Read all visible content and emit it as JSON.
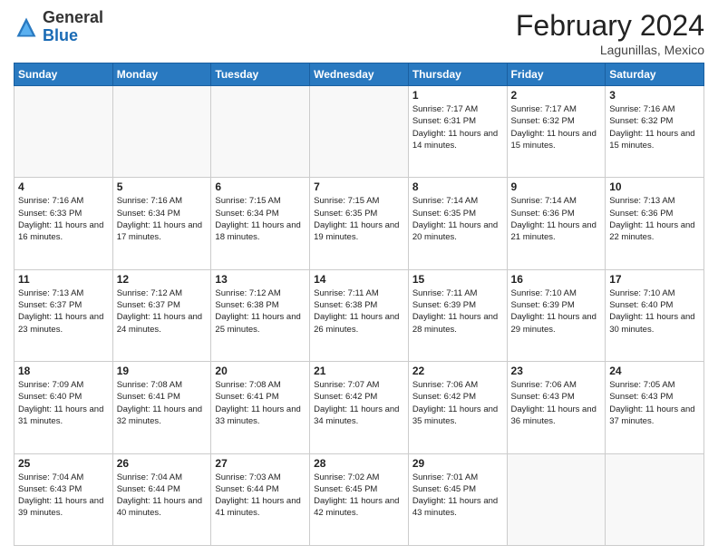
{
  "header": {
    "logo_general": "General",
    "logo_blue": "Blue",
    "month_year": "February 2024",
    "location": "Lagunillas, Mexico"
  },
  "weekdays": [
    "Sunday",
    "Monday",
    "Tuesday",
    "Wednesday",
    "Thursday",
    "Friday",
    "Saturday"
  ],
  "weeks": [
    [
      {
        "day": "",
        "info": ""
      },
      {
        "day": "",
        "info": ""
      },
      {
        "day": "",
        "info": ""
      },
      {
        "day": "",
        "info": ""
      },
      {
        "day": "1",
        "info": "Sunrise: 7:17 AM\nSunset: 6:31 PM\nDaylight: 11 hours and 14 minutes."
      },
      {
        "day": "2",
        "info": "Sunrise: 7:17 AM\nSunset: 6:32 PM\nDaylight: 11 hours and 15 minutes."
      },
      {
        "day": "3",
        "info": "Sunrise: 7:16 AM\nSunset: 6:32 PM\nDaylight: 11 hours and 15 minutes."
      }
    ],
    [
      {
        "day": "4",
        "info": "Sunrise: 7:16 AM\nSunset: 6:33 PM\nDaylight: 11 hours and 16 minutes."
      },
      {
        "day": "5",
        "info": "Sunrise: 7:16 AM\nSunset: 6:34 PM\nDaylight: 11 hours and 17 minutes."
      },
      {
        "day": "6",
        "info": "Sunrise: 7:15 AM\nSunset: 6:34 PM\nDaylight: 11 hours and 18 minutes."
      },
      {
        "day": "7",
        "info": "Sunrise: 7:15 AM\nSunset: 6:35 PM\nDaylight: 11 hours and 19 minutes."
      },
      {
        "day": "8",
        "info": "Sunrise: 7:14 AM\nSunset: 6:35 PM\nDaylight: 11 hours and 20 minutes."
      },
      {
        "day": "9",
        "info": "Sunrise: 7:14 AM\nSunset: 6:36 PM\nDaylight: 11 hours and 21 minutes."
      },
      {
        "day": "10",
        "info": "Sunrise: 7:13 AM\nSunset: 6:36 PM\nDaylight: 11 hours and 22 minutes."
      }
    ],
    [
      {
        "day": "11",
        "info": "Sunrise: 7:13 AM\nSunset: 6:37 PM\nDaylight: 11 hours and 23 minutes."
      },
      {
        "day": "12",
        "info": "Sunrise: 7:12 AM\nSunset: 6:37 PM\nDaylight: 11 hours and 24 minutes."
      },
      {
        "day": "13",
        "info": "Sunrise: 7:12 AM\nSunset: 6:38 PM\nDaylight: 11 hours and 25 minutes."
      },
      {
        "day": "14",
        "info": "Sunrise: 7:11 AM\nSunset: 6:38 PM\nDaylight: 11 hours and 26 minutes."
      },
      {
        "day": "15",
        "info": "Sunrise: 7:11 AM\nSunset: 6:39 PM\nDaylight: 11 hours and 28 minutes."
      },
      {
        "day": "16",
        "info": "Sunrise: 7:10 AM\nSunset: 6:39 PM\nDaylight: 11 hours and 29 minutes."
      },
      {
        "day": "17",
        "info": "Sunrise: 7:10 AM\nSunset: 6:40 PM\nDaylight: 11 hours and 30 minutes."
      }
    ],
    [
      {
        "day": "18",
        "info": "Sunrise: 7:09 AM\nSunset: 6:40 PM\nDaylight: 11 hours and 31 minutes."
      },
      {
        "day": "19",
        "info": "Sunrise: 7:08 AM\nSunset: 6:41 PM\nDaylight: 11 hours and 32 minutes."
      },
      {
        "day": "20",
        "info": "Sunrise: 7:08 AM\nSunset: 6:41 PM\nDaylight: 11 hours and 33 minutes."
      },
      {
        "day": "21",
        "info": "Sunrise: 7:07 AM\nSunset: 6:42 PM\nDaylight: 11 hours and 34 minutes."
      },
      {
        "day": "22",
        "info": "Sunrise: 7:06 AM\nSunset: 6:42 PM\nDaylight: 11 hours and 35 minutes."
      },
      {
        "day": "23",
        "info": "Sunrise: 7:06 AM\nSunset: 6:43 PM\nDaylight: 11 hours and 36 minutes."
      },
      {
        "day": "24",
        "info": "Sunrise: 7:05 AM\nSunset: 6:43 PM\nDaylight: 11 hours and 37 minutes."
      }
    ],
    [
      {
        "day": "25",
        "info": "Sunrise: 7:04 AM\nSunset: 6:43 PM\nDaylight: 11 hours and 39 minutes."
      },
      {
        "day": "26",
        "info": "Sunrise: 7:04 AM\nSunset: 6:44 PM\nDaylight: 11 hours and 40 minutes."
      },
      {
        "day": "27",
        "info": "Sunrise: 7:03 AM\nSunset: 6:44 PM\nDaylight: 11 hours and 41 minutes."
      },
      {
        "day": "28",
        "info": "Sunrise: 7:02 AM\nSunset: 6:45 PM\nDaylight: 11 hours and 42 minutes."
      },
      {
        "day": "29",
        "info": "Sunrise: 7:01 AM\nSunset: 6:45 PM\nDaylight: 11 hours and 43 minutes."
      },
      {
        "day": "",
        "info": ""
      },
      {
        "day": "",
        "info": ""
      }
    ]
  ]
}
